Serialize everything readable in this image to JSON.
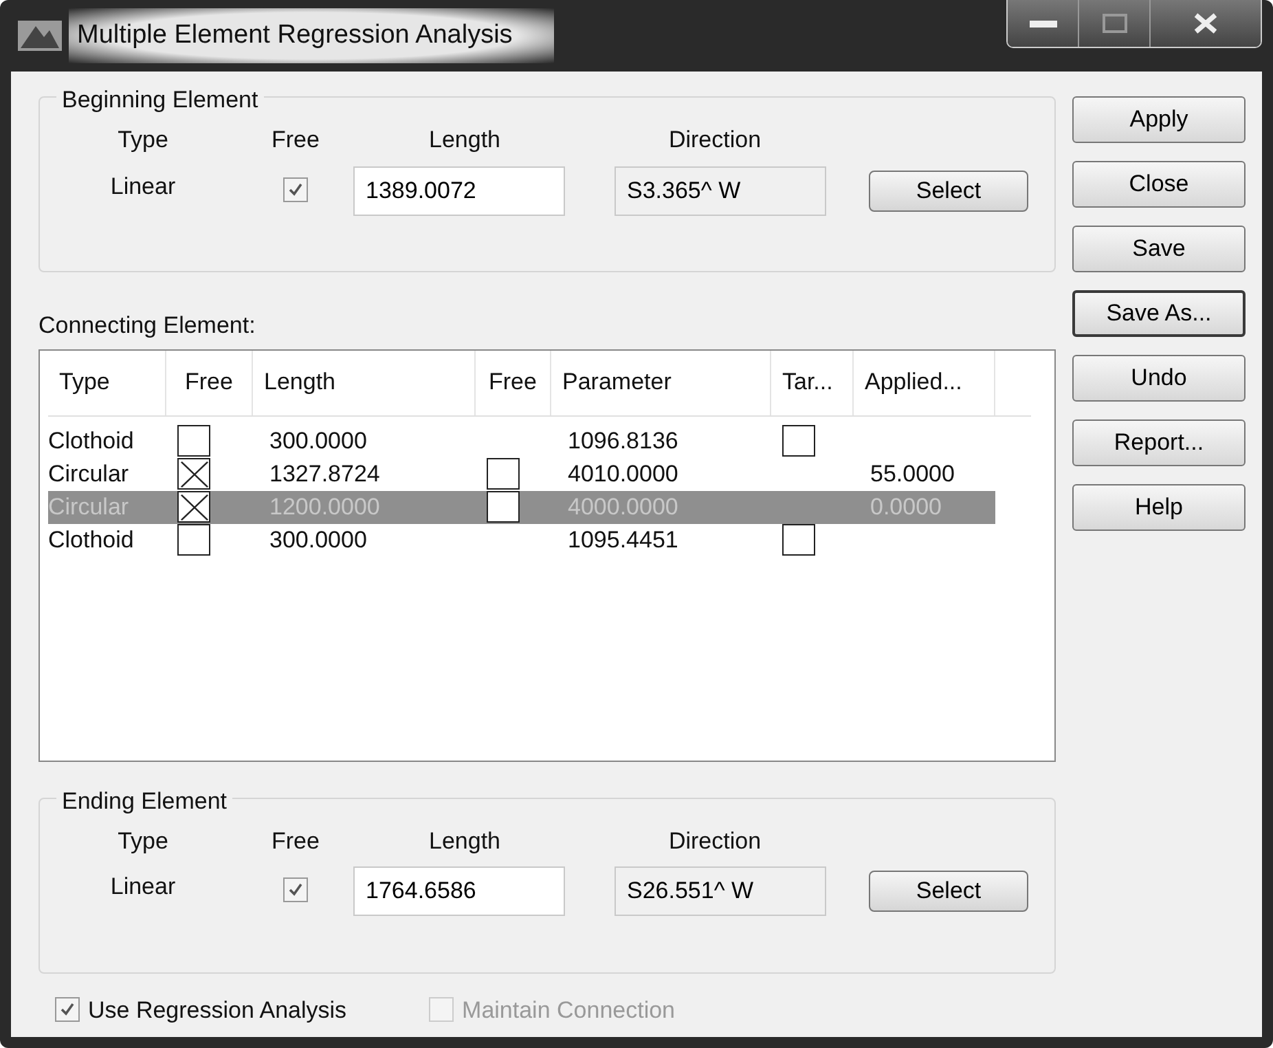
{
  "window": {
    "title": "Multiple Element Regression Analysis"
  },
  "beginning": {
    "title": "Beginning Element",
    "headers": [
      "Type",
      "Free",
      "Length",
      "Direction"
    ],
    "type": "Linear",
    "free_checked": true,
    "length": "1389.0072",
    "direction": "S3.365^ W",
    "button": "Select"
  },
  "connecting": {
    "label": "Connecting Element:",
    "columns": [
      "Type",
      "Free",
      "Length",
      "Free",
      "Parameter",
      "Tar...",
      "Applied..."
    ],
    "rows": [
      {
        "type": "Clothoid",
        "free": {
          "checked": false
        },
        "length": "300.0000",
        "parameter": "1096.8136",
        "target": {
          "checked": false
        },
        "selected": false
      },
      {
        "type": "Circular",
        "free": {
          "checked": true
        },
        "length": "1327.8724",
        "free_param": {
          "checked": false
        },
        "parameter": "4010.0000",
        "applied": "55.0000",
        "selected": false
      },
      {
        "type": "Circular",
        "free": {
          "checked": true
        },
        "length": "1200.0000",
        "free_param": {
          "checked": false
        },
        "parameter": "4000.0000",
        "applied": "0.0000",
        "selected": true
      },
      {
        "type": "Clothoid",
        "free": {
          "checked": false
        },
        "length": "300.0000",
        "parameter": "1095.4451",
        "target": {
          "checked": false
        },
        "selected": false
      }
    ]
  },
  "ending": {
    "title": "Ending Element",
    "headers": [
      "Type",
      "Free",
      "Length",
      "Direction"
    ],
    "type": "Linear",
    "free_checked": true,
    "length": "1764.6586",
    "direction": "S26.551^ W",
    "button": "Select"
  },
  "options": [
    {
      "label": "Use Regression Analysis",
      "checked": true,
      "disabled": false
    },
    {
      "label": "Maintain Connection",
      "checked": false,
      "disabled": true
    }
  ],
  "buttons": [
    {
      "label": "Apply",
      "focused": false
    },
    {
      "label": "Close",
      "focused": false
    },
    {
      "label": "Save",
      "focused": false
    },
    {
      "label": "Save As...",
      "focused": true
    },
    {
      "label": "Undo",
      "focused": false
    },
    {
      "label": "Report...",
      "focused": false
    },
    {
      "label": "Help",
      "focused": false
    }
  ]
}
